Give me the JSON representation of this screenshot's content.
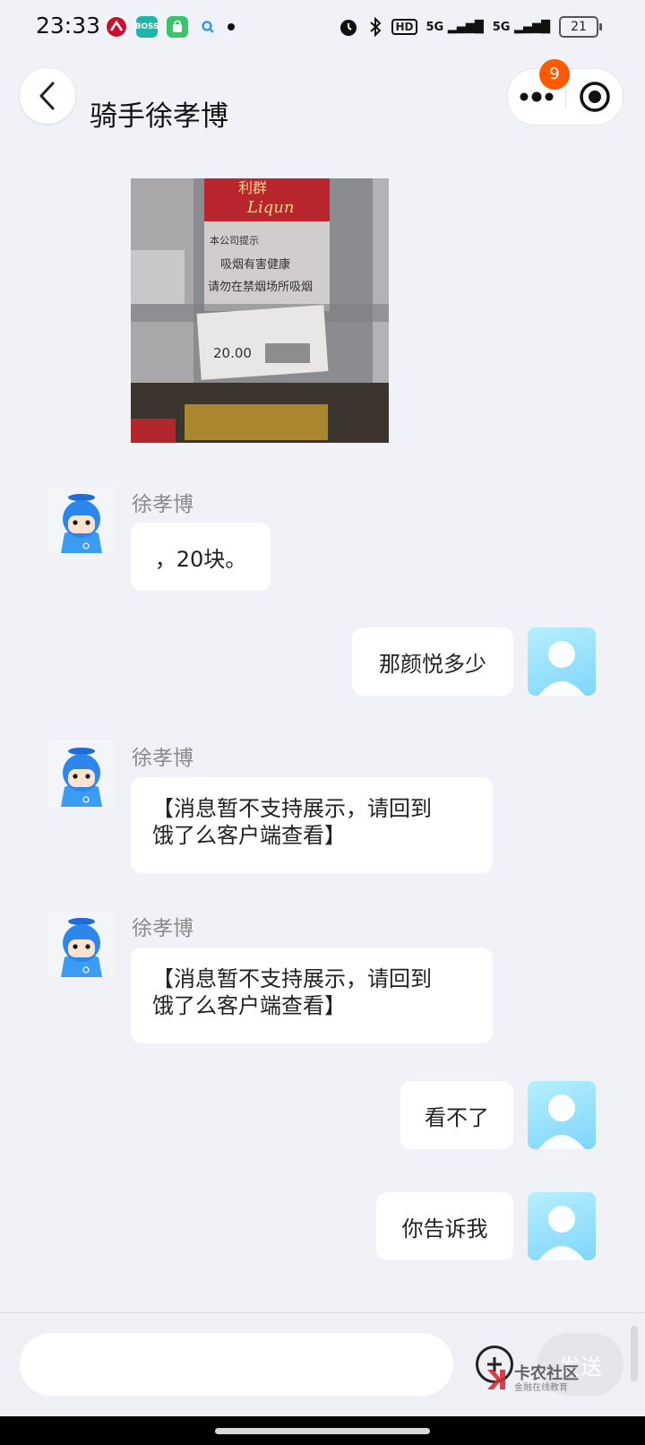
{
  "status_bar": {
    "time": "23:33",
    "app_icons": [
      {
        "name": "bank-app-icon",
        "label": "",
        "color": "#c8102e"
      },
      {
        "name": "boss-app-icon",
        "label": "BOSS",
        "color": "#1fb6a8"
      },
      {
        "name": "shopping-app-icon",
        "label": "",
        "color": "#3cc26a"
      },
      {
        "name": "search-app-icon",
        "label": "",
        "color": "#2f8cf5"
      }
    ],
    "signal_1": "5G",
    "signal_2": "5G",
    "hd_label": "HD",
    "battery": "21"
  },
  "header": {
    "title": "骑手徐孝博",
    "notification_badge": "9",
    "icons": {
      "back": "chevron-left-icon",
      "more": "more-dots-icon",
      "target": "target-icon"
    }
  },
  "messages": [
    {
      "side": "left",
      "type": "image",
      "image": {
        "brand_text": "Liqun",
        "brand_cn": "利群",
        "warn_1": "本公司提示",
        "warn_2": "吸烟有害健康",
        "warn_3": "请勿在禁烟场所吸烟",
        "price": "20.00"
      }
    },
    {
      "side": "left",
      "type": "text",
      "sender": "徐孝博",
      "text": "，20块。"
    },
    {
      "side": "right",
      "type": "text",
      "text": "那颜悦多少"
    },
    {
      "side": "left",
      "type": "text",
      "sender": "徐孝博",
      "lines": [
        "【消息暂不支持展示，请回到",
        "饿了么客户端查看】"
      ]
    },
    {
      "side": "left",
      "type": "text",
      "sender": "徐孝博",
      "lines": [
        "【消息暂不支持展示，请回到",
        "饿了么客户端查看】"
      ]
    },
    {
      "side": "right",
      "type": "text",
      "text": "看不了"
    },
    {
      "side": "right",
      "type": "text",
      "text": "你告诉我"
    }
  ],
  "input_bar": {
    "placeholder": "",
    "send_label": "发送",
    "watermark_title": "卡农社区",
    "watermark_sub": "金融在线教育"
  },
  "colors": {
    "background": "#f0f2f7",
    "badge": "#ff5a00",
    "bubble": "#ffffff",
    "user_avatar": "#9be3fd",
    "rider_avatar": "#2f8ff5"
  }
}
